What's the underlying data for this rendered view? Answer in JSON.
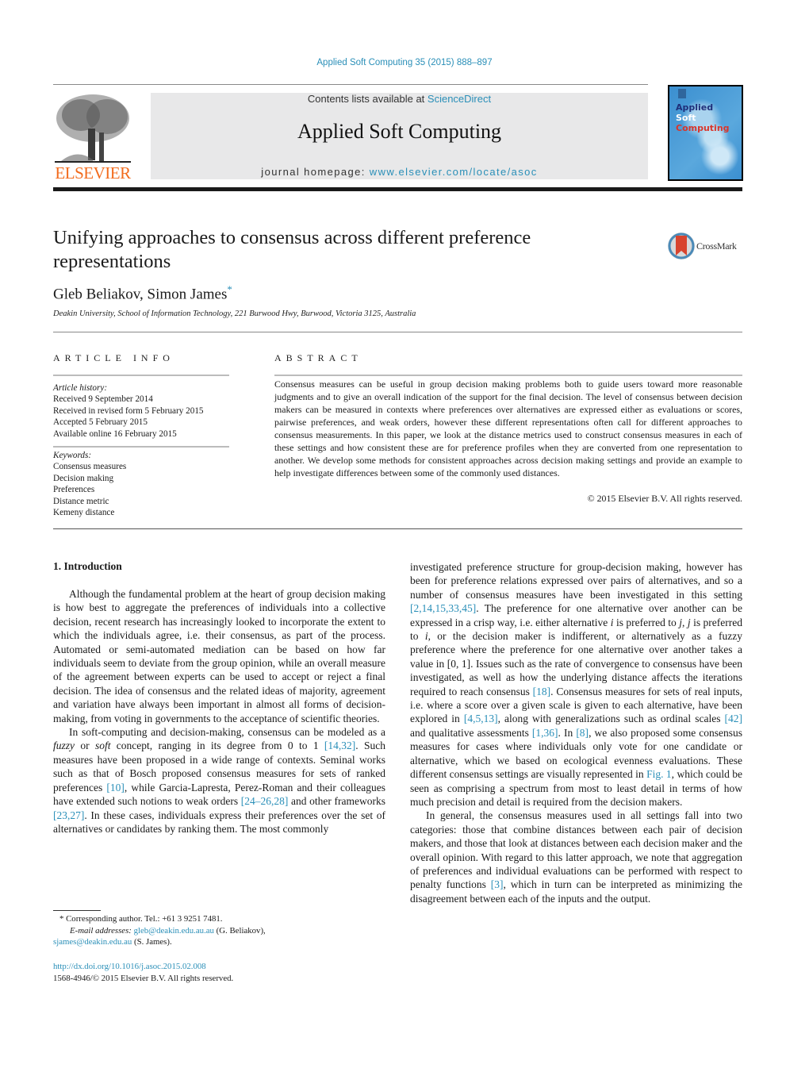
{
  "journal_ref": "Applied Soft Computing 35 (2015) 888–897",
  "masthead": {
    "contents_prefix": "Contents lists available at ",
    "contents_link": "ScienceDirect",
    "journal_title": "Applied Soft Computing",
    "homepage_prefix": "journal homepage: ",
    "homepage_link": "www.elsevier.com/locate/asoc",
    "publisher_logo": "ELSEVIER",
    "cover": {
      "line1": "Applied",
      "line2": "Soft",
      "line3": "Computing"
    }
  },
  "article": {
    "title": "Unifying approaches to consensus across different preference representations",
    "crossmark_label": "CrossMark",
    "authors": "Gleb Beliakov, Simon James",
    "corresponding_mark": "*",
    "affiliation": "Deakin University, School of Information Technology, 221 Burwood Hwy, Burwood, Victoria 3125, Australia"
  },
  "article_info": {
    "heading": "ARTICLE INFO",
    "history_label": "Article history:",
    "history": [
      "Received 9 September 2014",
      "Received in revised form 5 February 2015",
      "Accepted 5 February 2015",
      "Available online 16 February 2015"
    ],
    "keywords_label": "Keywords:",
    "keywords": [
      "Consensus measures",
      "Decision making",
      "Preferences",
      "Distance metric",
      "Kemeny distance"
    ]
  },
  "abstract": {
    "heading": "ABSTRACT",
    "text": "Consensus measures can be useful in group decision making problems both to guide users toward more reasonable judgments and to give an overall indication of the support for the final decision. The level of consensus between decision makers can be measured in contexts where preferences over alternatives are expressed either as evaluations or scores, pairwise preferences, and weak orders, however these different representations often call for different approaches to consensus measurements. In this paper, we look at the distance metrics used to construct consensus measures in each of these settings and how consistent these are for preference profiles when they are converted from one representation to another. We develop some methods for consistent approaches across decision making settings and provide an example to help investigate differences between some of the commonly used distances.",
    "copyright": "© 2015 Elsevier B.V. All rights reserved."
  },
  "body": {
    "section_heading": "1.  Introduction",
    "left": {
      "p1": "Although the fundamental problem at the heart of group decision making is how best to aggregate the preferences of individuals into a collective decision, recent research has increasingly looked to incorporate the extent to which the individuals agree, i.e. their consensus, as part of the process. Automated or semi-automated mediation can be based on how far individuals seem to deviate from the group opinion, while an overall measure of the agreement between experts can be used to accept or reject a final decision. The idea of consensus and the related ideas of majority, agreement and variation have always been important in almost all forms of decision-making, from voting in governments to the acceptance of scientific theories.",
      "p2_a": "In soft-computing and decision-making, consensus can be modeled as a ",
      "p2_fuzzy": "fuzzy",
      "p2_b": " or ",
      "p2_soft": "soft",
      "p2_c": " concept, ranging in its degree from 0 to 1 ",
      "p2_ref1": "[14,32]",
      "p2_d": ". Such measures have been proposed in a wide range of contexts. Seminal works such as that of Bosch proposed consensus measures for sets of ranked preferences ",
      "p2_ref2": "[10]",
      "p2_e": ", while Garcia-Lapresta, Perez-Roman and their colleagues have extended such notions to weak orders ",
      "p2_ref3": "[24–26,28]",
      "p2_f": " and other frameworks ",
      "p2_ref4": "[23,27]",
      "p2_g": ". In these cases, individuals express their preferences over the set of alternatives or candidates by ranking them. The most commonly"
    },
    "right": {
      "p1_a": "investigated preference structure for group-decision making, however has been for preference relations expressed over pairs of alternatives, and so a number of consensus measures have been investigated in this setting ",
      "p1_ref1": "[2,14,15,33,45]",
      "p1_b": ". The preference for one alternative over another can be expressed in a crisp way, i.e. either alternative ",
      "p1_i1": "i",
      "p1_c": " is preferred to ",
      "p1_j1": "j",
      "p1_d": ", ",
      "p1_j2": "j",
      "p1_e": " is preferred to ",
      "p1_i2": "i",
      "p1_f": ", or the decision maker is indifferent, or alternatively as a fuzzy preference where the preference for one alternative over another takes a value in [0, 1]. Issues such as the rate of convergence to consensus have been investigated, as well as how the underlying distance affects the iterations required to reach consensus ",
      "p1_ref2": "[18]",
      "p1_g": ". Consensus measures for sets of real inputs, i.e. where a score over a given scale is given to each alternative, have been explored in ",
      "p1_ref3": "[4,5,13]",
      "p1_h": ", along with generalizations such as ordinal scales ",
      "p1_ref4": "[42]",
      "p1_i": " and qualitative assessments ",
      "p1_ref5": "[1,36]",
      "p1_j": ". In ",
      "p1_ref6": "[8]",
      "p1_k": ", we also proposed some consensus measures for cases where individuals only vote for one candidate or alternative, which we based on ecological evenness evaluations. These different consensus settings are visually represented in ",
      "p1_ref7": "Fig. 1",
      "p1_l": ", which could be seen as comprising a spectrum from most to least detail in terms of how much precision and detail is required from the decision makers.",
      "p2_a": "In general, the consensus measures used in all settings fall into two categories: those that combine distances between each pair of decision makers, and those that look at distances between each decision maker and the overall opinion. With regard to this latter approach, we note that aggregation of preferences and individual evaluations can be performed with respect to penalty functions ",
      "p2_ref1": "[3]",
      "p2_b": ", which in turn can be interpreted as minimizing the disagreement between each of the inputs and the output."
    }
  },
  "footnote": {
    "mark": "*",
    "corresponding": " Corresponding author. Tel.: +61 3 9251 7481.",
    "email_label": "E-mail addresses:",
    "email1": "gleb@deakin.edu.au.au",
    "email1_name": " (G. Beliakov),",
    "email2": "sjames@deakin.edu.au",
    "email2_name": " (S. James)."
  },
  "doi": {
    "link": "http://dx.doi.org/10.1016/j.asoc.2015.02.008",
    "issn_line": "1568-4946/© 2015 Elsevier B.V. All rights reserved."
  },
  "colors": {
    "link": "#2a8fb8",
    "elsevier_orange": "#f26b1d",
    "masthead_bg": "#e8e8e9"
  }
}
